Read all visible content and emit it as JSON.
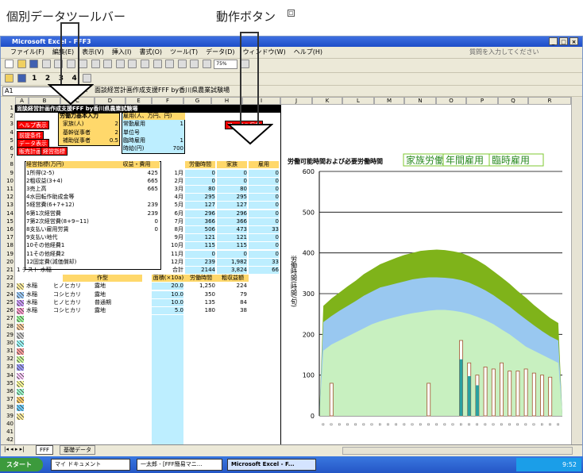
{
  "annotations": {
    "left": "個別データツールバー",
    "right": "動作ボタン"
  },
  "window": {
    "title": "Microsoft Excel - FFF3"
  },
  "menu": [
    "ファイル(F)",
    "編集(E)",
    "表示(V)",
    "挿入(I)",
    "書式(O)",
    "ツール(T)",
    "データ(D)",
    "ウィンドウ(W)",
    "ヘルプ(H)"
  ],
  "help_box": "質問を入力してください",
  "zoom": "75%",
  "custom_toolbar": [
    "1",
    "2",
    "3",
    "4"
  ],
  "namebox": "A1",
  "formula": "面談経営計画作成支援FFF by香川県農業試験場",
  "col_headers": [
    "A",
    "B",
    "C",
    "D",
    "E",
    "F",
    "G",
    "H",
    "I",
    "J",
    "K",
    "L",
    "M",
    "N",
    "O",
    "P",
    "Q",
    "R"
  ],
  "sheet": {
    "title": "面談経営計画作成支援FFF by香川県農業試験場",
    "buttons": [
      "ヘルプ表示",
      "前提条件",
      "データ表示",
      "販売計画",
      "経営指標"
    ],
    "labor_header": "労働力基本入力",
    "labor_rows": [
      "家族(人)",
      "基幹従事者",
      "補助従事者"
    ],
    "labor_vals": [
      "2",
      "2",
      "0.5"
    ],
    "hire_header": "雇用(人、万円、円)",
    "hire_rows": [
      "常勤雇用",
      "単位号",
      "臨時雇用",
      "時給(円)"
    ],
    "hire_vals": [
      "1",
      "",
      "1",
      "700"
    ],
    "action_button": "ファイル保存",
    "indicator_header": "経営指標(万円)",
    "indicator_col": "収益・費用",
    "indicators": [
      [
        "1所得(2-5)",
        "425"
      ],
      [
        "2粗収益(3+4)",
        "665"
      ],
      [
        "3売上高",
        "665"
      ],
      [
        "4水田転作助成金等",
        ""
      ],
      [
        "5経営費(6+7+12)",
        "239"
      ],
      [
        "6第1次経営費",
        "239"
      ],
      [
        "7第2次経営費(8+9~11)",
        "0"
      ],
      [
        "8支払い雇用労賃",
        "0"
      ],
      [
        "9支払い地代",
        ""
      ],
      [
        "10その他経費1",
        ""
      ],
      [
        "11その他経費2",
        ""
      ],
      [
        "12固定費(減価償却)",
        ""
      ]
    ],
    "month_cols": [
      "労働時間",
      "家族",
      "雇用"
    ],
    "months": [
      [
        "1月",
        "0",
        "0",
        "0"
      ],
      [
        "2月",
        "0",
        "0",
        "0"
      ],
      [
        "3月",
        "80",
        "80",
        "0"
      ],
      [
        "4月",
        "295",
        "295",
        "0"
      ],
      [
        "5月",
        "127",
        "127",
        "0"
      ],
      [
        "6月",
        "296",
        "296",
        "0"
      ],
      [
        "7月",
        "366",
        "366",
        "0"
      ],
      [
        "8月",
        "506",
        "473",
        "33"
      ],
      [
        "9月",
        "121",
        "121",
        "0"
      ],
      [
        "10月",
        "115",
        "115",
        "0"
      ],
      [
        "11月",
        "0",
        "0",
        "0"
      ],
      [
        "12月",
        "239",
        "1,982",
        "33"
      ],
      [
        "合計",
        "2144",
        "3,824",
        "66"
      ]
    ],
    "crop_header": "1 テスト 水稲",
    "crop_cols": [
      "作型",
      "面積(×10a)",
      "労働時間",
      "粗収益額"
    ],
    "crops": [
      [
        "水稲",
        "ヒノヒカリ",
        "露地",
        "20.0",
        "1,250",
        "224"
      ],
      [
        "水稲",
        "コシヒカリ",
        "露地",
        "10.0",
        "350",
        "79"
      ],
      [
        "水稲",
        "ヒノヒカリ",
        "普通期",
        "10.0",
        "135",
        "84"
      ],
      [
        "水稲",
        "コシヒカリ",
        "露地",
        "5.0",
        "180",
        "38"
      ]
    ],
    "row_numbers": [
      "1",
      "2",
      "3",
      "4",
      "5",
      "6",
      "7",
      "8",
      "9",
      "10",
      "11",
      "12",
      "13",
      "14",
      "15",
      "16",
      "17",
      "18",
      "19",
      "20",
      "21",
      "22",
      "23",
      "24",
      "25",
      "26",
      "27",
      "28",
      "29",
      "30",
      "31",
      "32",
      "33",
      "34",
      "35",
      "36",
      "37",
      "38",
      "39",
      "40",
      "41",
      "42"
    ]
  },
  "chart_data": {
    "type": "area",
    "title": "労働可能時間および必要労働時間",
    "legend": [
      "家族労働",
      "年間雇用",
      "臨時雇用"
    ],
    "ylabel": "労働時間(時間/旬)",
    "xlabel": "旬",
    "ylim": [
      0,
      600
    ],
    "yticks": [
      0,
      100,
      200,
      300,
      400,
      500,
      600
    ],
    "colors": {
      "family": "#c8f0c0",
      "year": "#99c8f0",
      "temp": "#7fb31a"
    },
    "family": [
      160,
      175,
      185,
      195,
      205,
      215,
      225,
      232,
      238,
      243,
      248,
      252,
      255,
      258,
      260,
      260,
      258,
      255,
      250,
      243,
      235,
      225,
      212,
      200,
      185,
      170,
      160,
      150,
      140,
      130
    ],
    "year": [
      230,
      245,
      258,
      270,
      282,
      295,
      305,
      315,
      320,
      325,
      330,
      335,
      338,
      340,
      340,
      339,
      337,
      333,
      327,
      318,
      308,
      296,
      282,
      268,
      252,
      237,
      222,
      208,
      195,
      185
    ],
    "temp": [
      270,
      288,
      303,
      318,
      332,
      348,
      360,
      372,
      380,
      388,
      395,
      400,
      405,
      407,
      408,
      407,
      404,
      400,
      392,
      382,
      370,
      355,
      340,
      324,
      306,
      290,
      272,
      256,
      240,
      228
    ],
    "need": [
      0,
      80,
      0,
      0,
      0,
      0,
      0,
      0,
      0,
      0,
      0,
      0,
      0,
      80,
      0,
      0,
      0,
      185,
      130,
      100,
      120,
      115,
      130,
      110,
      110,
      115,
      105,
      100,
      95,
      0
    ]
  },
  "sheet_tabs": [
    "FFF",
    "基礎データ"
  ],
  "taskbar": {
    "start": "スタート",
    "items": [
      "マイ ドキュメント",
      "一太郎 - [FFF簡易マニ...",
      "Microsoft Excel - F..."
    ],
    "clock": "9:52"
  }
}
